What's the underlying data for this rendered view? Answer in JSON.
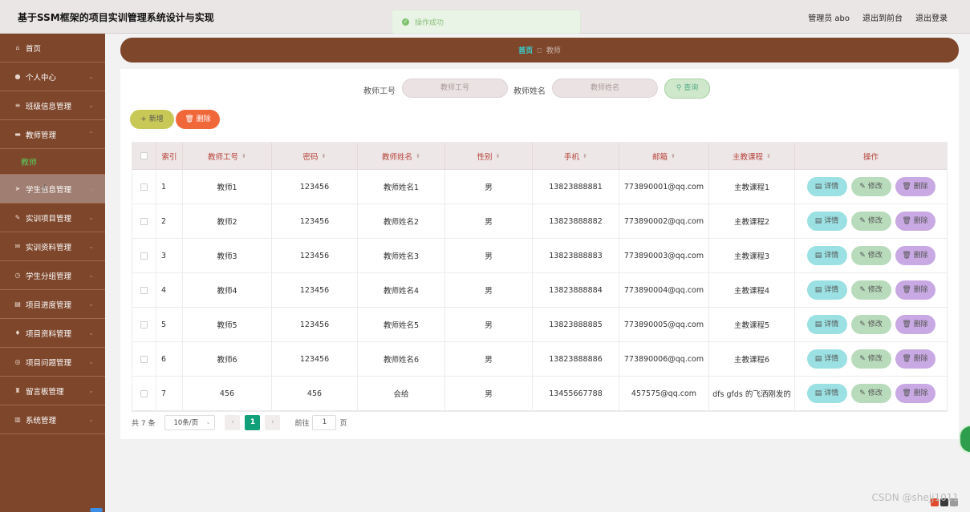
{
  "header": {
    "title": "基于SSM框架的项目实训管理系统设计与实现",
    "user": "管理员 abo",
    "to_front": "退出到前台",
    "logout": "退出登录"
  },
  "toast": {
    "text": "操作成功"
  },
  "sidebar": {
    "items": [
      {
        "label": "首页",
        "icon": "home-icon"
      },
      {
        "label": "个人中心",
        "icon": "user-icon"
      },
      {
        "label": "班级信息管理",
        "icon": "list-icon"
      },
      {
        "label": "教师管理",
        "icon": "card-icon"
      },
      {
        "label": "学生信息管理",
        "icon": "send-icon"
      },
      {
        "label": "实训项目管理",
        "icon": "edit-icon"
      },
      {
        "label": "实训资料管理",
        "icon": "mail-icon"
      },
      {
        "label": "学生分组管理",
        "icon": "clock-icon"
      },
      {
        "label": "项目进度管理",
        "icon": "doc-icon"
      },
      {
        "label": "项目资料管理",
        "icon": "bulb-icon"
      },
      {
        "label": "项目问题管理",
        "icon": "compass-icon"
      },
      {
        "label": "留言板管理",
        "icon": "trophy-icon"
      },
      {
        "label": "系统管理",
        "icon": "chart-icon"
      }
    ],
    "sub_item": "教师"
  },
  "breadcrumb": {
    "home": "首页",
    "current": "教师"
  },
  "search": {
    "label_id": "教师工号",
    "placeholder_id": "教师工号",
    "label_name": "教师姓名",
    "placeholder_name": "教师姓名",
    "button": "查询"
  },
  "actions": {
    "add": "新增",
    "delete": "删除"
  },
  "table": {
    "headers": {
      "index": "索引",
      "teacher_id": "教师工号",
      "password": "密码",
      "teacher_name": "教师姓名",
      "gender": "性别",
      "phone": "手机",
      "email": "邮箱",
      "course": "主教课程",
      "ops": "操作"
    },
    "op_labels": {
      "detail": "详情",
      "edit": "修改",
      "delete": "删除"
    },
    "rows": [
      {
        "index": "1",
        "teacher_id": "教师1",
        "password": "123456",
        "teacher_name": "教师姓名1",
        "gender": "男",
        "phone": "13823888881",
        "email": "773890001@qq.com",
        "course": "主教课程1"
      },
      {
        "index": "2",
        "teacher_id": "教师2",
        "password": "123456",
        "teacher_name": "教师姓名2",
        "gender": "男",
        "phone": "13823888882",
        "email": "773890002@qq.com",
        "course": "主教课程2"
      },
      {
        "index": "3",
        "teacher_id": "教师3",
        "password": "123456",
        "teacher_name": "教师姓名3",
        "gender": "男",
        "phone": "13823888883",
        "email": "773890003@qq.com",
        "course": "主教课程3"
      },
      {
        "index": "4",
        "teacher_id": "教师4",
        "password": "123456",
        "teacher_name": "教师姓名4",
        "gender": "男",
        "phone": "13823888884",
        "email": "773890004@qq.com",
        "course": "主教课程4"
      },
      {
        "index": "5",
        "teacher_id": "教师5",
        "password": "123456",
        "teacher_name": "教师姓名5",
        "gender": "男",
        "phone": "13823888885",
        "email": "773890005@qq.com",
        "course": "主教课程5"
      },
      {
        "index": "6",
        "teacher_id": "教师6",
        "password": "123456",
        "teacher_name": "教师姓名6",
        "gender": "男",
        "phone": "13823888886",
        "email": "773890006@qq.com",
        "course": "主教课程6"
      },
      {
        "index": "7",
        "teacher_id": "456",
        "password": "456",
        "teacher_name": "会给",
        "gender": "男",
        "phone": "13455667788",
        "email": "457575@qq.com",
        "course": "dfs gfds 的飞洒刚发的"
      }
    ]
  },
  "pagination": {
    "total": "共 7 条",
    "page_size": "10条/页",
    "current_page": "1",
    "goto_label": "前往",
    "goto_value": "1",
    "page_suffix": "页"
  },
  "watermark": "CSDN @shejj1011",
  "colors": {
    "sidebar": "#7e462b",
    "accent_green": "#11a07a",
    "header": "#ebe6e6"
  }
}
